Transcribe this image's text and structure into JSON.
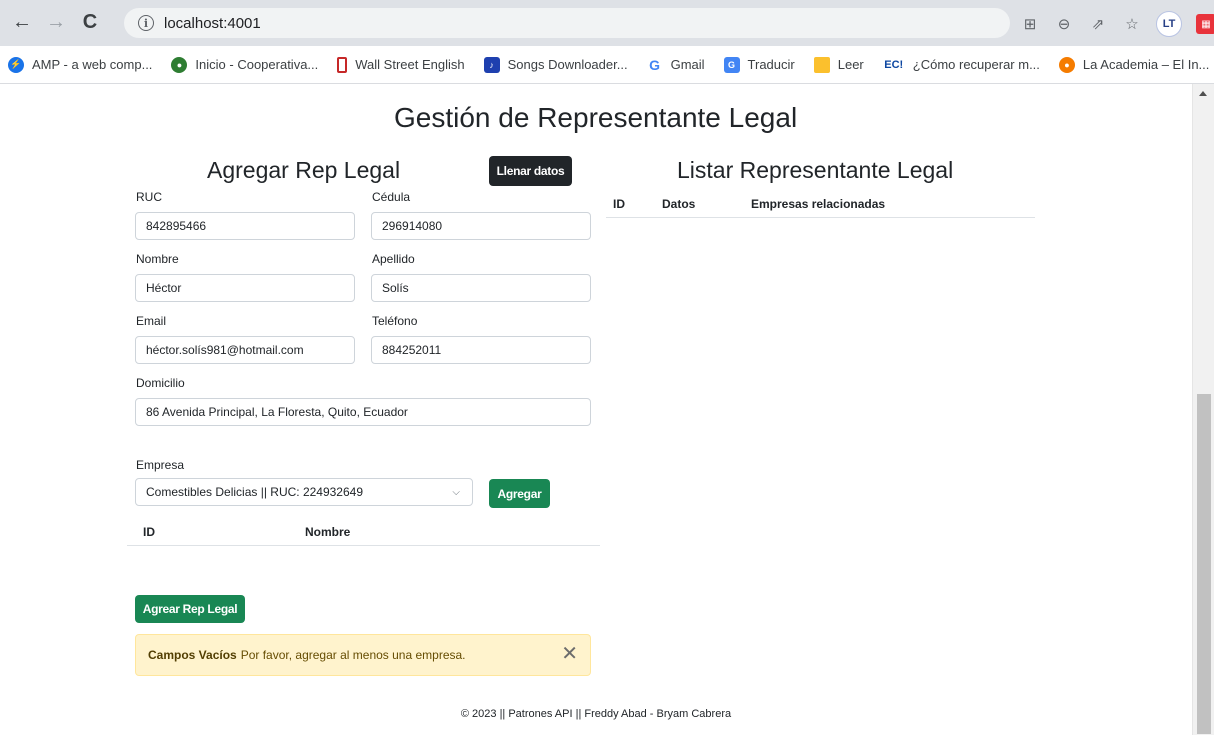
{
  "browser": {
    "url": "localhost:4001",
    "bookmarks": [
      {
        "label": "AMP - a web comp...",
        "icon": "amp-icon",
        "color": "#1a73e8"
      },
      {
        "label": "Inicio - Cooperativa...",
        "icon": "cooperativa-icon",
        "color": "#2e7d32"
      },
      {
        "label": "Wall Street English",
        "icon": "wse-icon",
        "color": "#c62828"
      },
      {
        "label": "Songs Downloader...",
        "icon": "songs-icon",
        "color": "#1e40af"
      },
      {
        "label": "Gmail",
        "icon": "google-icon",
        "color": "#4285f4"
      },
      {
        "label": "Traducir",
        "icon": "translate-icon",
        "color": "#4285f4"
      },
      {
        "label": "Leer",
        "icon": "folder-icon",
        "color": "#fbc02d"
      },
      {
        "label": "¿Cómo recuperar m...",
        "icon": "ec-icon",
        "color": "#0d47a1"
      },
      {
        "label": "La Academia – El In...",
        "icon": "academia-icon",
        "color": "#f57c00"
      }
    ]
  },
  "page": {
    "title": "Gestión de Representante Legal",
    "form": {
      "title": "Agregar Rep Legal",
      "fill_button": "Llenar datos",
      "fields": {
        "ruc": {
          "label": "RUC",
          "value": "842895466"
        },
        "cedula": {
          "label": "Cédula",
          "value": "296914080"
        },
        "nombre": {
          "label": "Nombre",
          "value": "Héctor"
        },
        "apellido": {
          "label": "Apellido",
          "value": "Solís"
        },
        "email": {
          "label": "Email",
          "value": "héctor.solís981@hotmail.com"
        },
        "telefono": {
          "label": "Teléfono",
          "value": "884252011"
        },
        "domicilio": {
          "label": "Domicilio",
          "value": "86 Avenida Principal, La Floresta, Quito, Ecuador"
        }
      },
      "empresa": {
        "label": "Empresa",
        "selected": "Comestibles Delicias || RUC: 224932649",
        "add_button": "Agregar",
        "table_headers": [
          "ID",
          "Nombre"
        ]
      },
      "submit_button": "Agrear Rep Legal",
      "alert": {
        "title": "Campos Vacíos",
        "message": "Por favor, agregar al menos una empresa."
      }
    },
    "list": {
      "title": "Listar Representante Legal",
      "headers": [
        "ID",
        "Datos",
        "Empresas relacionadas"
      ]
    },
    "footer": "© 2023 || Patrones API || Freddy Abad - Bryam Cabrera"
  }
}
